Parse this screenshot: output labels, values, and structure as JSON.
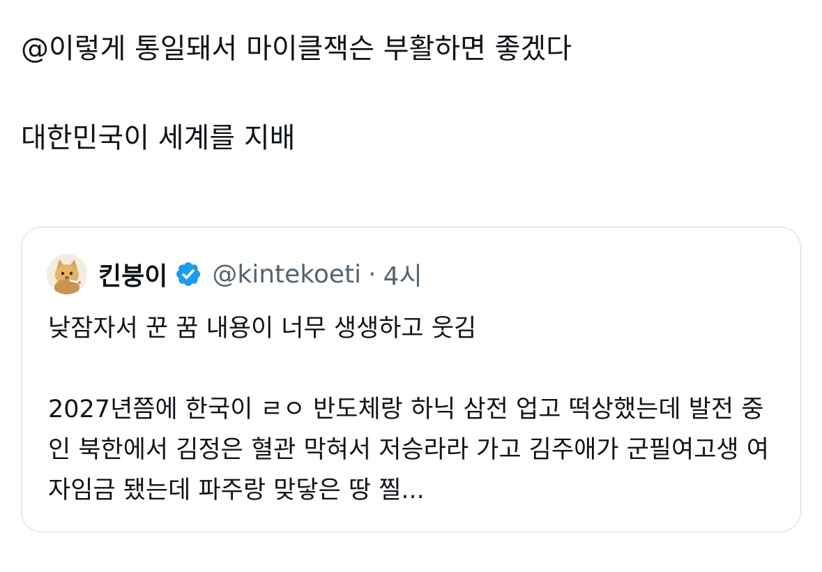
{
  "tweet": {
    "text": "@이렇게 통일돼서 마이클잭슨 부활하면 좋겠다\n\n대한민국이 세계를 지배"
  },
  "quote": {
    "display_name": "킨붕이",
    "verified_icon": "verified-badge-icon",
    "handle": "@kintekoeti",
    "separator": "·",
    "time": "4시",
    "paragraph_1": "낮잠자서 꾼 꿈 내용이 너무 생생하고 웃김",
    "paragraph_2": "2027년쯤에 한국이 ㄹㅇ 반도체랑 하닉 삼전 업고 떡상했는데 발전 중인 북한에서 김정은 혈관 막혀서 저승라라 가고 김주애가 군필여고생 여자임금 됐는데 파주랑 맞닿은 땅 찔...",
    "colors": {
      "verified": "#1d9bf0",
      "secondary_text": "#536471",
      "border": "#d5dbe0"
    }
  }
}
